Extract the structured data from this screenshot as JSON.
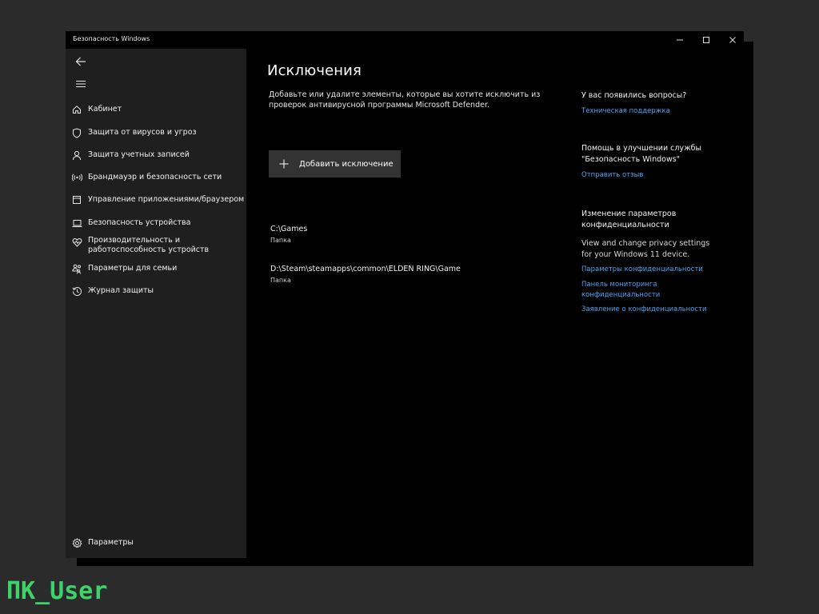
{
  "window": {
    "title": "Безопасность Windows"
  },
  "sidebar": {
    "items": [
      {
        "label": "Кабинет",
        "icon": "home-icon"
      },
      {
        "label": "Защита от вирусов и угроз",
        "icon": "shield-icon"
      },
      {
        "label": "Защита учетных записей",
        "icon": "person-icon"
      },
      {
        "label": "Брандмауэр и безопасность сети",
        "icon": "wifi-signal-icon"
      },
      {
        "label": "Управление приложениями/браузером",
        "icon": "app-window-icon"
      },
      {
        "label": "Безопасность устройства",
        "icon": "laptop-icon"
      },
      {
        "label": "Производительность и работоспособность устройств",
        "icon": "heart-pulse-icon"
      },
      {
        "label": "Параметры для семьи",
        "icon": "family-icon"
      },
      {
        "label": "Журнал защиты",
        "icon": "history-icon"
      }
    ],
    "settings_label": "Параметры"
  },
  "main": {
    "title": "Исключения",
    "description": "Добавьте или удалите элементы, которые вы хотите исключить из проверок антивирусной программы Microsoft Defender.",
    "add_button_label": "Добавить исключение",
    "exclusions": [
      {
        "path": "C:\\Games",
        "type": "Папка"
      },
      {
        "path": "D:\\Steam\\steamapps\\common\\ELDEN RING\\Game",
        "type": "Папка"
      }
    ]
  },
  "side_panel": {
    "questions_heading": "У вас появились вопросы?",
    "support_link": "Техническая поддержка",
    "improve_heading": "Помощь в улучшении службы \"Безопасность Windows\"",
    "feedback_link": "Отправить отзыв",
    "privacy_heading": "Изменение параметров конфиденциальности",
    "privacy_text": "View and change privacy settings for your Windows 11 device.",
    "privacy_links": [
      "Параметры конфиденциальности",
      "Панель мониторинга конфиденциальности",
      "Заявление о конфиденциальности"
    ]
  },
  "watermark": "ПК_User",
  "colors": {
    "accent_link": "#4aa3f0",
    "brand_green": "#3dd36a",
    "sidebar_bg": "#1f1f1f",
    "button_bg": "#333333"
  }
}
